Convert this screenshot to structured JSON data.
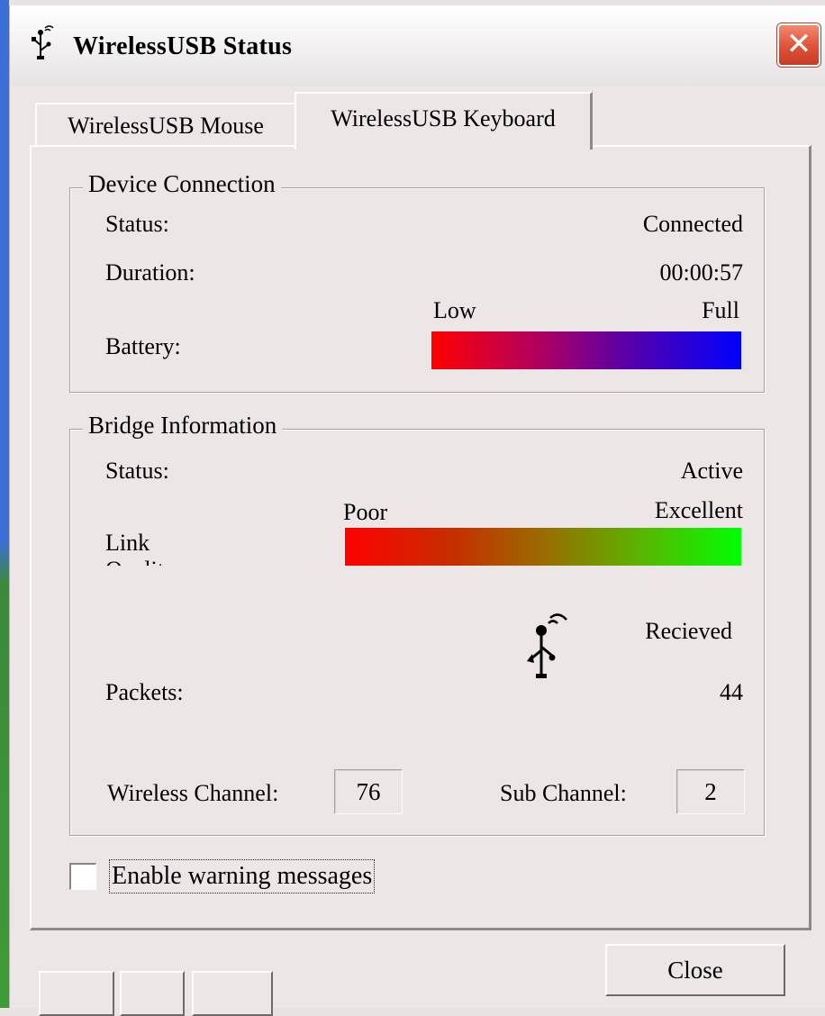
{
  "window": {
    "title": "WirelessUSB Status",
    "close_glyph": "✕"
  },
  "tabs": [
    {
      "label": "WirelessUSB Mouse",
      "active": false
    },
    {
      "label": "WirelessUSB Keyboard",
      "active": true
    }
  ],
  "device_connection": {
    "title": "Device Connection",
    "status_label": "Status:",
    "status_value": "Connected",
    "duration_label": "Duration:",
    "duration_value": "00:00:57",
    "battery_label": "Battery:",
    "battery_low": "Low",
    "battery_full": "Full"
  },
  "bridge_information": {
    "title": "Bridge Information",
    "status_label": "Status:",
    "status_value": "Active",
    "link_label": "Link Quality:",
    "link_poor": "Poor",
    "link_excellent": "Excellent",
    "received_label": "Recieved",
    "packets_label": "Packets:",
    "packets_value": "44",
    "wireless_channel_label": "Wireless Channel:",
    "wireless_channel_value": "76",
    "sub_channel_label": "Sub Channel:",
    "sub_channel_value": "2"
  },
  "options": {
    "enable_warning_label": "Enable warning messages",
    "enable_warning_checked": false
  },
  "buttons": {
    "close_label": "Close"
  },
  "icons": {
    "title_icon": "wireless-usb-icon",
    "packets_icon": "usb-wireless-icon"
  },
  "colors": {
    "title_close_button": "#e0553c",
    "battery_low": "#ff0000",
    "battery_full": "#0000ff",
    "link_poor": "#ff0000",
    "link_excellent": "#00ff00"
  }
}
